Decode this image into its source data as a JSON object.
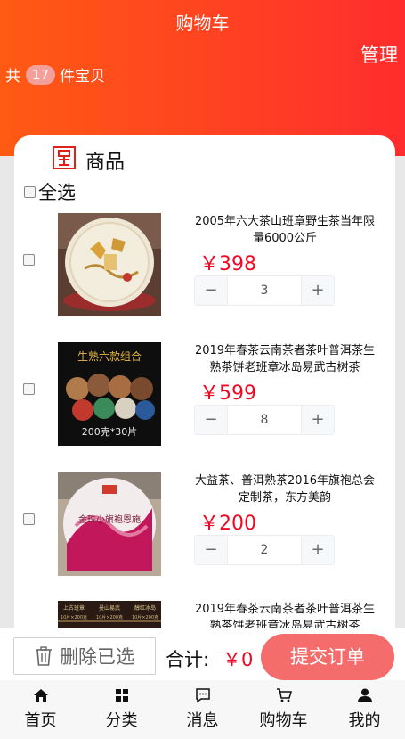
{
  "header": {
    "title": "购物车",
    "manage": "管理",
    "count_prefix": "共",
    "count": "17",
    "count_suffix": "件宝贝"
  },
  "section": {
    "label": "商品",
    "select_all": "全选"
  },
  "items": [
    {
      "name": "2005年六大茶山班章野生茶当年限量6000公斤",
      "price": "￥398",
      "quantity": "3"
    },
    {
      "name": "2019年春茶云南茶者茶叶普洱茶生熟茶饼老班章冰岛易武古树茶",
      "price": "￥599",
      "quantity": "8",
      "image_text_top": "生熟六款组合",
      "image_text_bottom": "200克*30片"
    },
    {
      "name": "大益茶、普洱熟茶2016年旗袍总会定制茶，东方美韵",
      "price": "￥200",
      "quantity": "2",
      "image_text": "金珠小旗袍恩施"
    },
    {
      "name": "2019年春茶云南茶者茶叶普洱茶生熟茶饼老班章冰岛易武古树茶",
      "image_text_labels": [
        "上古班章",
        "曼山易武",
        "醇红冰岛"
      ],
      "image_text_sizes": [
        "10片×200克",
        "10片×200克",
        "10片×200克"
      ]
    }
  ],
  "stepper": {
    "minus": "−",
    "plus": "+"
  },
  "bottom_bar": {
    "delete_label": "删除已选",
    "total_label": "合计:",
    "total_value": "￥0",
    "submit_label": "提交订单"
  },
  "tabbar": [
    {
      "label": "首页",
      "icon": "home-icon"
    },
    {
      "label": "分类",
      "icon": "grid-icon"
    },
    {
      "label": "消息",
      "icon": "message-icon"
    },
    {
      "label": "购物车",
      "icon": "cart-icon"
    },
    {
      "label": "我的",
      "icon": "user-icon"
    }
  ],
  "colors": {
    "header_start": "#ff5a14",
    "header_end": "#ff2d2d",
    "price": "#ee0a24",
    "submit": "#f56c6c",
    "badge": "#f4a09a"
  }
}
